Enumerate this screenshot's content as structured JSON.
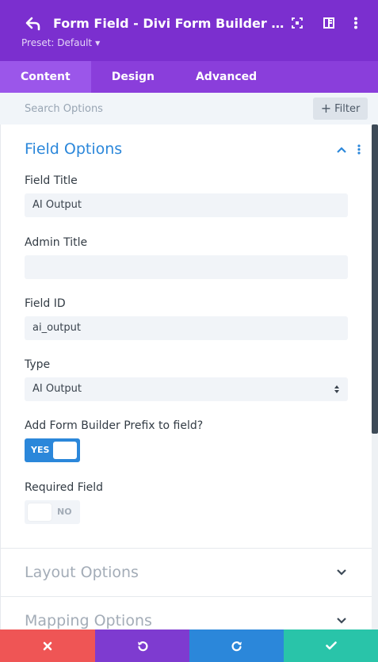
{
  "header": {
    "title": "Form Field - Divi Form Builder S...",
    "preset_label": "Preset: Default",
    "bg_color": "#7b2fcf"
  },
  "tabs": [
    {
      "label": "Content",
      "active": true
    },
    {
      "label": "Design",
      "active": false
    },
    {
      "label": "Advanced",
      "active": false
    }
  ],
  "search": {
    "placeholder": "Search Options",
    "filter_label": "Filter"
  },
  "field_options": {
    "title": "Field Options",
    "field_title_label": "Field Title",
    "field_title_value": "AI Output",
    "admin_title_label": "Admin Title",
    "admin_title_value": "",
    "field_id_label": "Field ID",
    "field_id_value": "ai_output",
    "type_label": "Type",
    "type_value": "AI Output",
    "prefix_label": "Add Form Builder Prefix to field?",
    "prefix_toggle": "YES",
    "required_label": "Required Field",
    "required_toggle": "NO"
  },
  "layout_options": {
    "title": "Layout Options"
  },
  "mapping_options": {
    "title": "Mapping Options"
  },
  "footer": {
    "colors": {
      "cancel": "#ef5555",
      "undo": "#7e3bd0",
      "redo": "#2b87da",
      "save": "#29c4a9"
    },
    "icons": [
      "close-icon",
      "undo-icon",
      "redo-icon",
      "check-icon"
    ]
  },
  "accent_color": "#2b87da"
}
